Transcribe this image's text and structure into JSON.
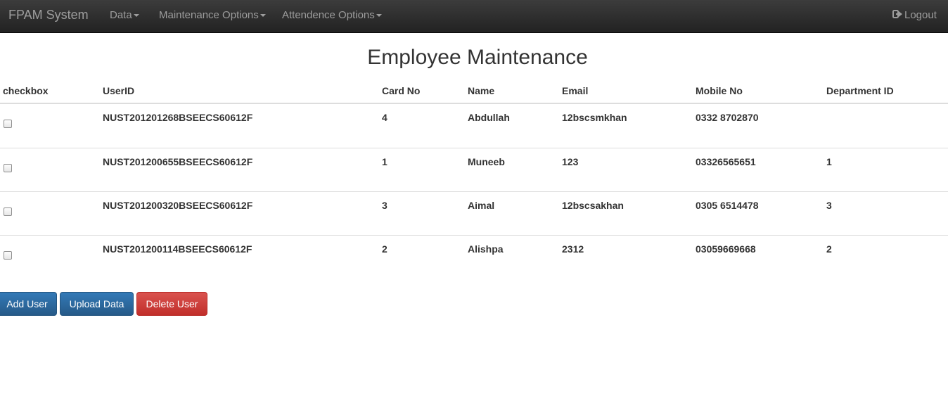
{
  "navbar": {
    "brand": "FPAM System",
    "menus": [
      {
        "label": "Data"
      },
      {
        "label": "Maintenance Options"
      },
      {
        "label": "Attendence Options"
      }
    ],
    "logout_label": "Logout"
  },
  "page": {
    "title": "Employee Maintenance"
  },
  "table": {
    "headers": [
      "checkbox",
      "UserID",
      "Card No",
      "Name",
      "Email",
      "Mobile No",
      "Department ID"
    ],
    "rows": [
      {
        "checked": false,
        "user_id": "NUST201201268BSEECS60612F",
        "card_no": "4",
        "name": "Abdullah",
        "email": "12bscsmkhan",
        "mobile": "0332 8702870",
        "department_id": ""
      },
      {
        "checked": false,
        "user_id": "NUST201200655BSEECS60612F",
        "card_no": "1",
        "name": "Muneeb",
        "email": "123",
        "mobile": "03326565651",
        "department_id": "1"
      },
      {
        "checked": false,
        "user_id": "NUST201200320BSEECS60612F",
        "card_no": "3",
        "name": "Aimal",
        "email": "12bscsakhan",
        "mobile": "0305 6514478",
        "department_id": "3"
      },
      {
        "checked": false,
        "user_id": "NUST201200114BSEECS60612F",
        "card_no": "2",
        "name": "Alishpa",
        "email": "2312",
        "mobile": "03059669668",
        "department_id": "2"
      }
    ]
  },
  "actions": {
    "add_label": "Add User",
    "upload_label": "Upload Data",
    "delete_label": "Delete User"
  },
  "colors": {
    "navbar": "#222222",
    "nav_text": "#9d9d9d",
    "primary": "#337ab7",
    "danger": "#d9534f"
  },
  "icons": {
    "logout": "logout-icon",
    "caret": "caret-down-icon"
  }
}
